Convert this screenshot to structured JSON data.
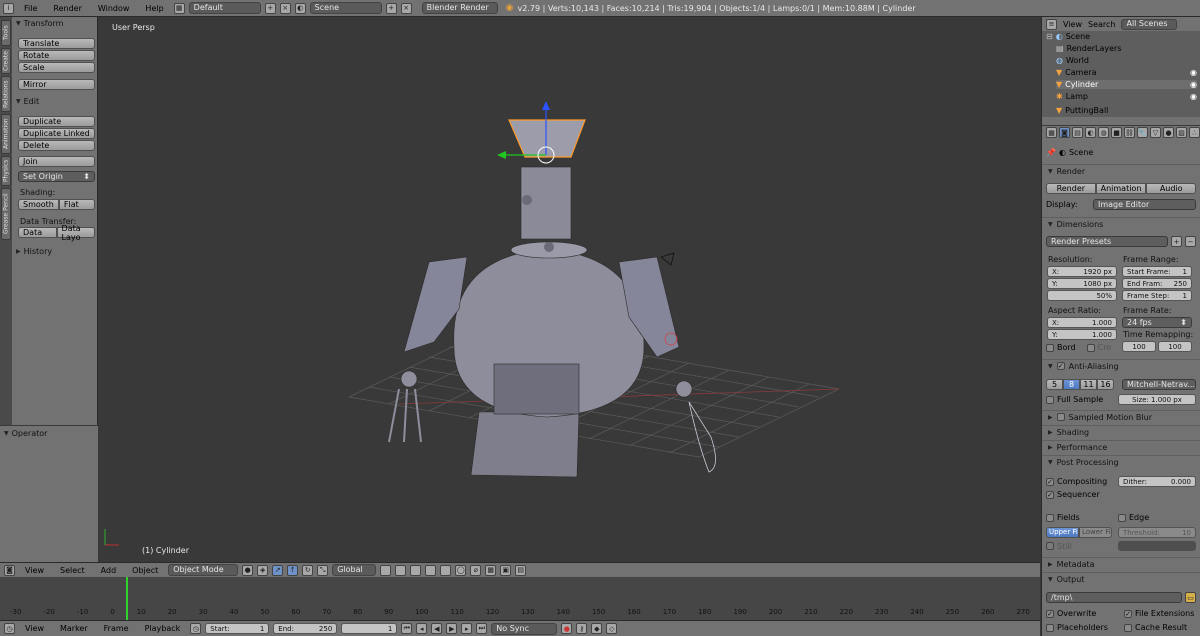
{
  "topbar": {
    "menus": [
      "File",
      "Render",
      "Window",
      "Help"
    ],
    "layout": "Default",
    "scene": "Scene",
    "engine": "Blender Render",
    "stats": "v2.79 | Verts:10,143 | Faces:10,214 | Tris:19,904 | Objects:1/4 | Lamps:0/1 | Mem:10.88M | Cylinder"
  },
  "lefttabs": [
    "Tools",
    "Create",
    "Relations",
    "Animation",
    "Physics",
    "Grease Pencil"
  ],
  "toolshelf": {
    "transform": {
      "title": "Transform",
      "buttons": [
        "Translate",
        "Rotate",
        "Scale",
        "Mirror"
      ]
    },
    "edit": {
      "title": "Edit",
      "buttons": [
        "Duplicate",
        "Duplicate Linked",
        "Delete",
        "Join"
      ],
      "set_origin": "Set Origin",
      "shading_label": "Shading:",
      "smooth": "Smooth",
      "flat": "Flat",
      "data_transfer_label": "Data Transfer:",
      "data": "Data",
      "data_layo": "Data Layo"
    },
    "history": "History",
    "operator": "Operator"
  },
  "viewport": {
    "label": "User Persp",
    "object": "(1) Cylinder"
  },
  "outliner": {
    "menus": [
      "View",
      "Search"
    ],
    "filter": "All Scenes",
    "items": [
      "Scene",
      "RenderLayers",
      "World",
      "Camera",
      "Cylinder",
      "Lamp",
      "PuttingBall"
    ]
  },
  "properties": {
    "scene": "Scene",
    "render": {
      "title": "Render",
      "render_btn": "Render",
      "animation_btn": "Animation",
      "audio_btn": "Audio",
      "display_label": "Display:",
      "display": "Image Editor"
    },
    "dimensions": {
      "title": "Dimensions",
      "presets": "Render Presets",
      "resolution": "Resolution:",
      "x": "X:",
      "x_val": "1920 px",
      "y": "Y:",
      "y_val": "1080 px",
      "pct": "50%",
      "frame_range": "Frame Range:",
      "start": "Start Frame:",
      "start_val": "1",
      "end": "End Fram:",
      "end_val": "250",
      "step": "Frame Step:",
      "step_val": "1",
      "aspect": "Aspect Ratio:",
      "ax": "X:",
      "ax_val": "1.000",
      "ay": "Y:",
      "ay_val": "1.000",
      "frame_rate": "Frame Rate:",
      "fps": "24 fps",
      "time_remap": "Time Remapping:",
      "remap_a": "100",
      "remap_b": "100",
      "bord": "Bord",
      "cro": "Cro"
    },
    "aa": {
      "title": "Anti-Aliasing",
      "samples": [
        "5",
        "8",
        "11",
        "16"
      ],
      "filter": "Mitchell-Netrav...",
      "full_sample": "Full Sample",
      "size": "Size: 1.000 px"
    },
    "sections": [
      "Sampled Motion Blur",
      "Shading",
      "Performance",
      "Post Processing"
    ],
    "post": {
      "compositing": "Compositing",
      "dither": "Dither:",
      "dither_val": "0.000",
      "sequencer": "Sequencer",
      "fields": "Fields",
      "edge": "Edge",
      "upper": "Upper Firs",
      "lower": "Lower Firs",
      "threshold": "Threshold:",
      "threshold_val": "10",
      "still": "Still"
    },
    "metadata": "Metadata",
    "output": {
      "title": "Output",
      "path": "/tmp\\",
      "overwrite": "Overwrite",
      "file_ext": "File Extensions",
      "placeholders": "Placeholders",
      "cache": "Cache Result"
    }
  },
  "vpheader": {
    "menus": [
      "View",
      "Select",
      "Add",
      "Object"
    ],
    "mode": "Object Mode",
    "orientation": "Global"
  },
  "timeline": {
    "ticks": [
      "-30",
      "-20",
      "-10",
      "0",
      "10",
      "20",
      "30",
      "40",
      "50",
      "60",
      "70",
      "80",
      "90",
      "100",
      "110",
      "120",
      "130",
      "140",
      "150",
      "160",
      "170",
      "180",
      "190",
      "200",
      "210",
      "220",
      "230",
      "240",
      "250",
      "260",
      "270"
    ]
  },
  "tlheader": {
    "menus": [
      "View",
      "Marker",
      "Frame",
      "Playback"
    ],
    "start": "Start:",
    "start_val": "1",
    "end": "End:",
    "end_val": "250",
    "current": "1",
    "sync": "No Sync"
  }
}
